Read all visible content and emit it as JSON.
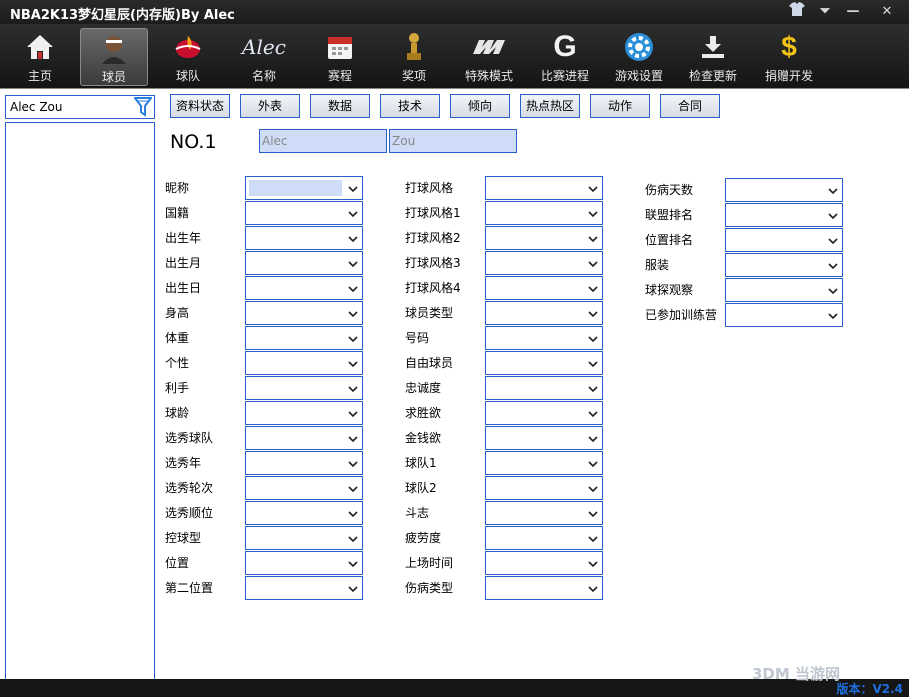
{
  "window": {
    "title": "NBA2K13梦幻星辰(内存版)By Alec",
    "version_label": "版本：V2.4"
  },
  "toolbar": [
    {
      "label": "主页",
      "icon": "home-icon"
    },
    {
      "label": "球员",
      "icon": "player-avatar-icon",
      "active": true
    },
    {
      "label": "球队",
      "icon": "team-logo-icon"
    },
    {
      "label": "名称",
      "icon": "alec-signature-icon",
      "icon_text": "Alec"
    },
    {
      "label": "赛程",
      "icon": "calendar-icon"
    },
    {
      "label": "奖项",
      "icon": "trophy-icon"
    },
    {
      "label": "特殊模式",
      "icon": "special-mode-icon"
    },
    {
      "label": "比赛进程",
      "icon": "gatorade-g-icon",
      "icon_text": "G"
    },
    {
      "label": "游戏设置",
      "icon": "gear-icon"
    },
    {
      "label": "检查更新",
      "icon": "download-icon"
    },
    {
      "label": "捐赠开发",
      "icon": "dollar-icon",
      "icon_text": "$"
    }
  ],
  "search": {
    "value": "Alec Zou"
  },
  "tabs": [
    "资料状态",
    "外表",
    "数据",
    "技术",
    "倾向",
    "热点热区",
    "动作",
    "合同"
  ],
  "player": {
    "number_label": "NO.1",
    "first_name": "Alec",
    "last_name": "Zou"
  },
  "fields": {
    "col1": [
      "昵称",
      "国籍",
      "出生年",
      "出生月",
      "出生日",
      "身高",
      "体重",
      "个性",
      "利手",
      "球龄",
      "选秀球队",
      "选秀年",
      "选秀轮次",
      "选秀顺位",
      "控球型",
      "位置",
      "第二位置"
    ],
    "col2": [
      "打球风格",
      "打球风格1",
      "打球风格2",
      "打球风格3",
      "打球风格4",
      "球员类型",
      "号码",
      "自由球员",
      "忠诚度",
      "求胜欲",
      "金钱欲",
      "球队1",
      "球队2",
      "斗志",
      "疲劳度",
      "上场时间",
      "伤病类型"
    ],
    "col3": [
      "伤病天数",
      "联盟排名",
      "位置排名",
      "服装",
      "球探观察",
      "已参加训练营"
    ]
  },
  "watermark": "3DM 当游网",
  "colors": {
    "accent_border": "#2a5fcc",
    "selection": "#cfdcf7",
    "version": "#1d6fe0"
  }
}
